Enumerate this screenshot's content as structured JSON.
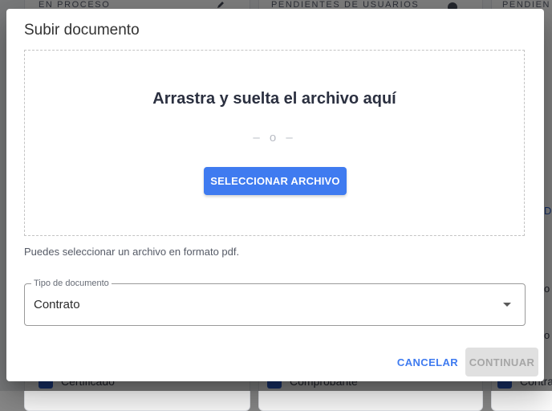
{
  "background": {
    "headers": [
      "EN PROCESO",
      "PENDIENTES DE USUARIOS",
      "PENDIENTE"
    ],
    "rows": [
      "Certificado",
      "Comprobante",
      "Contra"
    ],
    "side_glyphs": [
      "D",
      "o",
      "o"
    ]
  },
  "dialog": {
    "title": "Subir documento",
    "dropzone": {
      "title": "Arrastra y suelta el archivo aquí",
      "separator": "– o –",
      "select_button": "SELECCIONAR ARCHIVO"
    },
    "hint": "Puedes seleccionar un archivo en formato pdf.",
    "doc_type": {
      "label": "Tipo de documento",
      "value": "Contrato"
    },
    "actions": {
      "cancel": "CANCELAR",
      "continue": "CONTINUAR"
    }
  },
  "colors": {
    "primary": "#3f7bf0",
    "disabled_bg": "#e0e0e0",
    "disabled_text": "#a6a6a6"
  },
  "icons": {
    "select_caret": "chevron-down-icon",
    "bg_edit": "pencil-icon"
  }
}
